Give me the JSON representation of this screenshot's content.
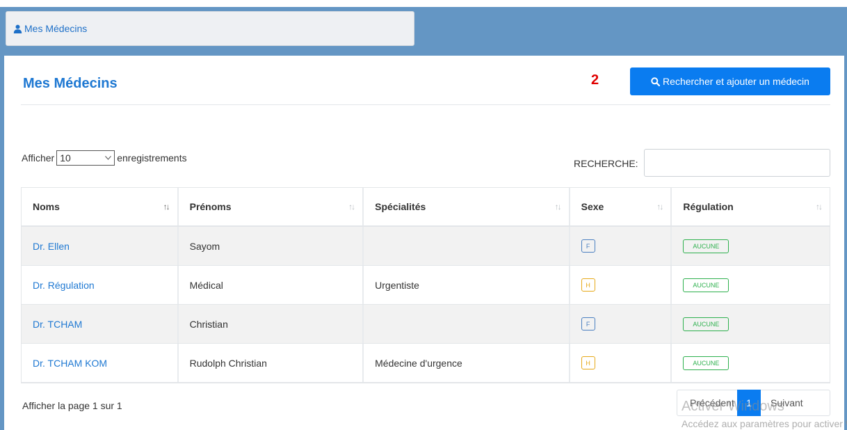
{
  "top_tab": {
    "label": "Mes Médecins",
    "icon": "doctor-icon"
  },
  "card": {
    "title": "Mes Médecins",
    "annotation_mark": "2",
    "search_button_label": "Rechercher et ajouter un médecin"
  },
  "controls": {
    "show_prefix": "Afficher",
    "page_length": "10",
    "show_suffix": "enregistrements",
    "search_label": "RECHERCHE:",
    "search_value": ""
  },
  "table": {
    "headers": [
      "Noms",
      "Prénoms",
      "Spécialités",
      "Sexe",
      "Régulation"
    ],
    "rows": [
      {
        "nom": "Dr. Ellen",
        "prenom": "Sayom",
        "specialite": "",
        "sexe": "F",
        "regulation": "AUCUNE"
      },
      {
        "nom": "Dr. Régulation",
        "prenom": "Médical",
        "specialite": "Urgentiste",
        "sexe": "H",
        "regulation": "AUCUNE"
      },
      {
        "nom": "Dr. TCHAM",
        "prenom": "Christian",
        "specialite": "",
        "sexe": "F",
        "regulation": "AUCUNE"
      },
      {
        "nom": "Dr. TCHAM KOM",
        "prenom": "Rudolph Christian",
        "specialite": "Médecine d'urgence",
        "sexe": "H",
        "regulation": "AUCUNE"
      }
    ]
  },
  "footer": {
    "page_info": "Afficher la page 1 sur 1",
    "prev_label": "Précédent",
    "current_page": "1",
    "next_label": "Suivant"
  },
  "watermark": {
    "line1": "Activer Windows",
    "line2": "Accédez aux paramètres pour activer Windows."
  },
  "colors": {
    "header_bg": "#6496c4",
    "accent": "#1e78d2",
    "primary_button": "#0a7cf0",
    "badge_f": "#4a7fc0",
    "badge_h": "#e6a817",
    "badge_regulation": "#2db04d",
    "annotation": "#e00000"
  }
}
